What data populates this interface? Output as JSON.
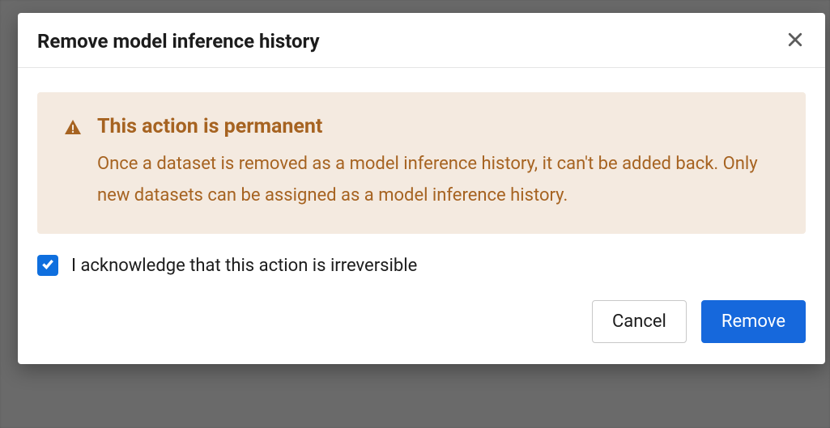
{
  "dialog": {
    "title": "Remove model inference history",
    "warning": {
      "heading": "This action is permanent",
      "body": "Once a dataset is removed as a model inference history, it can't be added back. Only new datasets can be assigned as a model inference history."
    },
    "acknowledge": {
      "label": "I acknowledge that this action is irreversible",
      "checked": true
    },
    "buttons": {
      "cancel": "Cancel",
      "confirm": "Remove"
    }
  }
}
